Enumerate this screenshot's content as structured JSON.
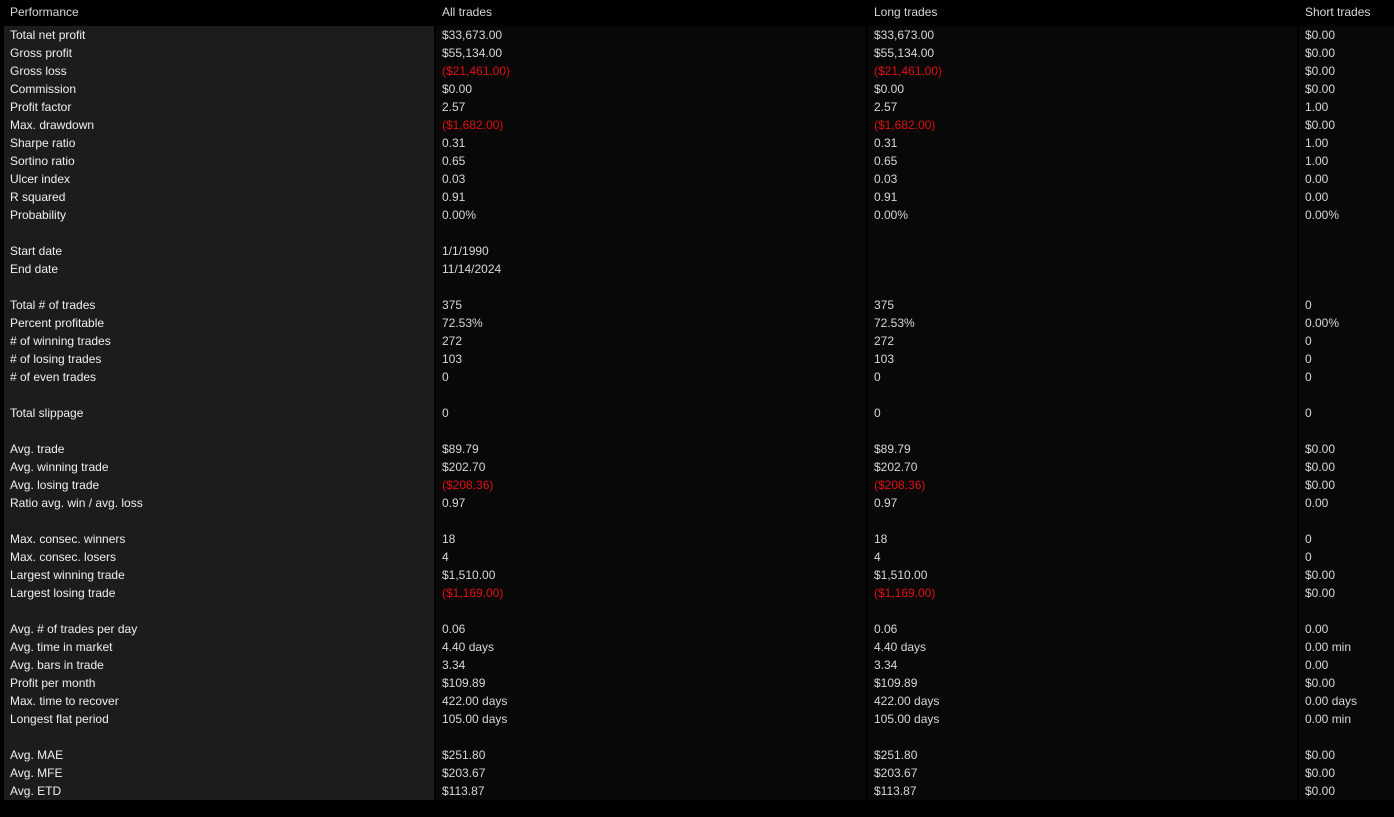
{
  "header": {
    "title": "Performance",
    "columns": [
      "All trades",
      "Long trades",
      "Short trades"
    ]
  },
  "colors": {
    "negative": "#e01010",
    "label_bg": "#1c1c1c",
    "value_bg": "#080808",
    "background": "#000000"
  },
  "rows": [
    {
      "label": "Total net profit",
      "all": "$33,673.00",
      "long": "$33,673.00",
      "short": "$0.00"
    },
    {
      "label": "Gross profit",
      "all": "$55,134.00",
      "long": "$55,134.00",
      "short": "$0.00"
    },
    {
      "label": "Gross loss",
      "all": "($21,461.00)",
      "long": "($21,461.00)",
      "short": "$0.00",
      "negative": [
        "all",
        "long"
      ]
    },
    {
      "label": "Commission",
      "all": "$0.00",
      "long": "$0.00",
      "short": "$0.00"
    },
    {
      "label": "Profit factor",
      "all": "2.57",
      "long": "2.57",
      "short": "1.00"
    },
    {
      "label": "Max. drawdown",
      "all": "($1,682.00)",
      "long": "($1,682.00)",
      "short": "$0.00",
      "negative": [
        "all",
        "long"
      ]
    },
    {
      "label": "Sharpe ratio",
      "all": "0.31",
      "long": "0.31",
      "short": "1.00"
    },
    {
      "label": "Sortino ratio",
      "all": "0.65",
      "long": "0.65",
      "short": "1.00"
    },
    {
      "label": "Ulcer index",
      "all": "0.03",
      "long": "0.03",
      "short": "0.00"
    },
    {
      "label": "R squared",
      "all": "0.91",
      "long": "0.91",
      "short": "0.00"
    },
    {
      "label": "Probability",
      "all": "0.00%",
      "long": "0.00%",
      "short": "0.00%"
    },
    {
      "spacer": true
    },
    {
      "label": "Start date",
      "all": "1/1/1990",
      "long": "",
      "short": ""
    },
    {
      "label": "End date",
      "all": "11/14/2024",
      "long": "",
      "short": ""
    },
    {
      "spacer": true
    },
    {
      "label": "Total # of trades",
      "all": "375",
      "long": "375",
      "short": "0"
    },
    {
      "label": "Percent profitable",
      "all": "72.53%",
      "long": "72.53%",
      "short": "0.00%"
    },
    {
      "label": "# of winning trades",
      "all": "272",
      "long": "272",
      "short": "0"
    },
    {
      "label": "# of losing trades",
      "all": "103",
      "long": "103",
      "short": "0"
    },
    {
      "label": "# of even trades",
      "all": "0",
      "long": "0",
      "short": "0"
    },
    {
      "spacer": true
    },
    {
      "label": "Total slippage",
      "all": "0",
      "long": "0",
      "short": "0"
    },
    {
      "spacer": true
    },
    {
      "label": "Avg. trade",
      "all": "$89.79",
      "long": "$89.79",
      "short": "$0.00"
    },
    {
      "label": "Avg. winning trade",
      "all": "$202.70",
      "long": "$202.70",
      "short": "$0.00"
    },
    {
      "label": "Avg. losing trade",
      "all": "($208.36)",
      "long": "($208.36)",
      "short": "$0.00",
      "negative": [
        "all",
        "long"
      ]
    },
    {
      "label": "Ratio avg. win / avg. loss",
      "all": "0.97",
      "long": "0.97",
      "short": "0.00"
    },
    {
      "spacer": true
    },
    {
      "label": "Max. consec. winners",
      "all": "18",
      "long": "18",
      "short": "0"
    },
    {
      "label": "Max. consec. losers",
      "all": "4",
      "long": "4",
      "short": "0"
    },
    {
      "label": "Largest winning trade",
      "all": "$1,510.00",
      "long": "$1,510.00",
      "short": "$0.00"
    },
    {
      "label": "Largest losing trade",
      "all": "($1,169.00)",
      "long": "($1,169.00)",
      "short": "$0.00",
      "negative": [
        "all",
        "long"
      ]
    },
    {
      "spacer": true
    },
    {
      "label": "Avg. # of trades per day",
      "all": "0.06",
      "long": "0.06",
      "short": "0.00"
    },
    {
      "label": "Avg. time in market",
      "all": "4.40 days",
      "long": "4.40 days",
      "short": "0.00 min"
    },
    {
      "label": "Avg. bars in trade",
      "all": "3.34",
      "long": "3.34",
      "short": "0.00"
    },
    {
      "label": "Profit per month",
      "all": "$109.89",
      "long": "$109.89",
      "short": "$0.00"
    },
    {
      "label": "Max. time to recover",
      "all": "422.00 days",
      "long": "422.00 days",
      "short": "0.00 days"
    },
    {
      "label": "Longest flat period",
      "all": "105.00 days",
      "long": "105.00 days",
      "short": "0.00 min"
    },
    {
      "spacer": true
    },
    {
      "label": "Avg. MAE",
      "all": "$251.80",
      "long": "$251.80",
      "short": "$0.00"
    },
    {
      "label": "Avg. MFE",
      "all": "$203.67",
      "long": "$203.67",
      "short": "$0.00"
    },
    {
      "label": "Avg. ETD",
      "all": "$113.87",
      "long": "$113.87",
      "short": "$0.00"
    }
  ]
}
